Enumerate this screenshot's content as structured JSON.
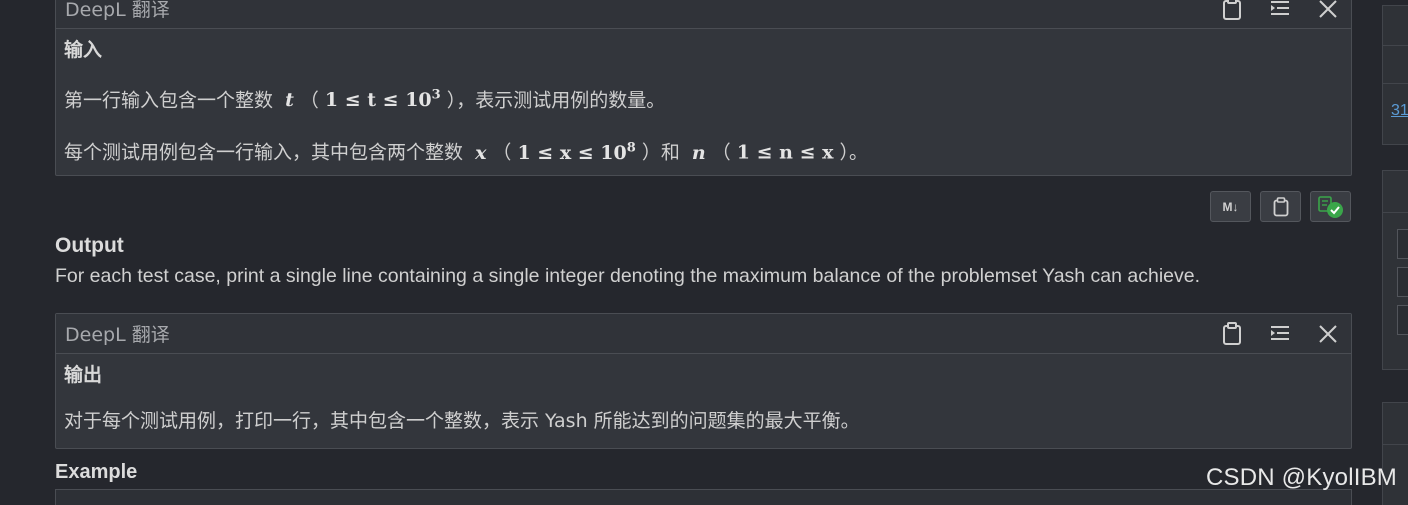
{
  "panel_input": {
    "title": "DeepL 翻译",
    "heading": "输入",
    "line1_pre": "第一行输入包含一个整数",
    "line1_var": "t",
    "line1_cond_open": "（",
    "line1_cond": "1 ≤ t ≤ 10",
    "line1_sup": "3",
    "line1_post": "），表示测试用例的数量。",
    "line2_pre": "每个测试用例包含一行输入，其中包含两个整数",
    "line2_var1": "x",
    "line2_cond1_open": "（",
    "line2_cond1": "1 ≤ x ≤ 10",
    "line2_sup1": "8",
    "line2_mid": "）和",
    "line2_var2": "n",
    "line2_cond2_open": "（",
    "line2_cond2": "1 ≤ n ≤ x",
    "line2_post": "）。"
  },
  "toolbar": {
    "md_label": "M↓"
  },
  "output": {
    "heading": "Output",
    "text": "For each test case, print a single line containing a single integer denoting the maximum balance of the problemset Yash can achieve."
  },
  "panel_output": {
    "title": "DeepL 翻译",
    "heading": "输出",
    "text": "对于每个测试用例，打印一行，其中包含一个整数，表示 Yash 所能达到的问题集的最大平衡。"
  },
  "example": {
    "heading": "Example"
  },
  "sidebar": {
    "link_fragment": "31"
  },
  "watermark": "CSDN @KyolIBM",
  "colors": {
    "accent_green": "#3aa64a",
    "link": "#5b9bd5"
  }
}
